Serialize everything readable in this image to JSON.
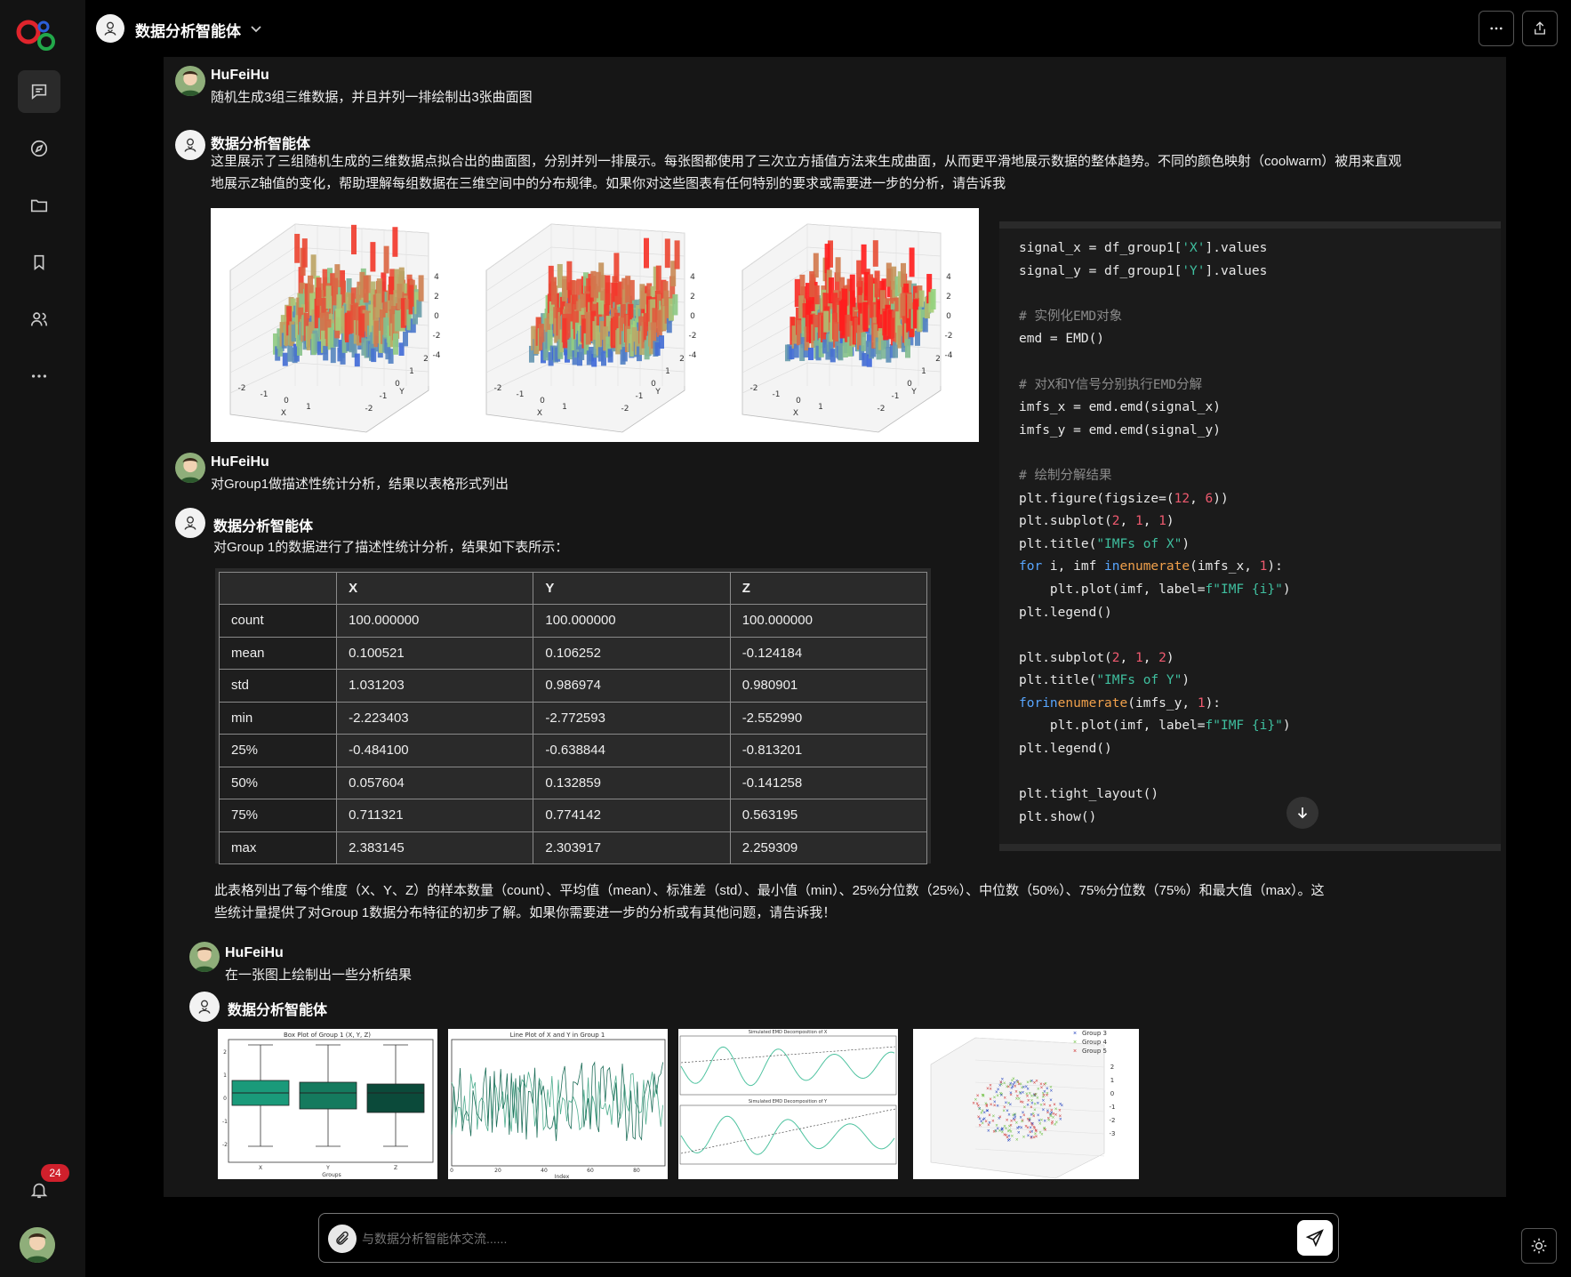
{
  "header": {
    "title": "数据分析智能体"
  },
  "sidebar": {
    "badge": "24"
  },
  "messages": {
    "u1": {
      "name": "HuFeiHu",
      "text": "随机生成3组三维数据，并且并列一排绘制出3张曲面图"
    },
    "b1": {
      "name": "数据分析智能体",
      "line1": "这里展示了三组随机生成的三维数据点拟合出的曲面图，分别并列一排展示。每张图都使用了三次立方插值方法来生成曲面，从而更平滑地展示数据的整体趋势。不同的颜色映射（coolwarm）被用来直观",
      "line2": "地展示Z轴值的变化，帮助理解每组数据在三维空间中的分布规律。如果你对这些图表有任何特别的要求或需要进一步的分析，请告诉我"
    },
    "u2": {
      "name": "HuFeiHu",
      "text": "对Group1做描述性统计分析，结果以表格形式列出"
    },
    "b2": {
      "name": "数据分析智能体",
      "intro": "对Group 1的数据进行了描述性统计分析，结果如下表所示：",
      "summary1": "此表格列出了每个维度（X、Y、Z）的样本数量（count）、平均值（mean）、标准差（std）、最小值（min）、25%分位数（25%）、中位数（50%）、75%分位数（75%）和最大值（max）。这",
      "summary2": "些统计量提供了对Group 1数据分布特征的初步了解。如果你需要进一步的分析或有其他问题，请告诉我！"
    },
    "u3": {
      "name": "HuFeiHu",
      "text": "在一张图上绘制出一些分析结果"
    },
    "b3": {
      "name": "数据分析智能体"
    }
  },
  "surface_axes": {
    "ticks_x": [
      "-2",
      "-1",
      "0",
      "1"
    ],
    "ticks_y": [
      "-2",
      "-1",
      "0",
      "1",
      "2"
    ],
    "xlabel": "X",
    "ylabel": "Y"
  },
  "stats_table": {
    "headers": [
      "",
      "X",
      "Y",
      "Z"
    ],
    "rows": [
      [
        "count",
        "100.000000",
        "100.000000",
        "100.000000"
      ],
      [
        "mean",
        "0.100521",
        "0.106252",
        "-0.124184"
      ],
      [
        "std",
        "1.031203",
        "0.986974",
        "0.980901"
      ],
      [
        "min",
        "-2.223403",
        "-2.772593",
        "-2.552990"
      ],
      [
        "25%",
        "-0.484100",
        "-0.638844",
        "-0.813201"
      ],
      [
        "50%",
        "0.057604",
        "0.132859",
        "-0.141258"
      ],
      [
        "75%",
        "0.711321",
        "0.774142",
        "0.563195"
      ],
      [
        "max",
        "2.383145",
        "2.303917",
        "2.259309"
      ]
    ]
  },
  "code_lines": [
    [
      [
        "",
        "signal_x = df_group1["
      ],
      [
        "st",
        "'X'"
      ],
      [
        "",
        "].values"
      ]
    ],
    [
      [
        "",
        "signal_y = df_group1["
      ],
      [
        "st",
        "'Y'"
      ],
      [
        "",
        "].values"
      ]
    ],
    [],
    [
      [
        "cm",
        "# 实例化EMD对象"
      ]
    ],
    [
      [
        "",
        "emd = EMD()"
      ]
    ],
    [],
    [
      [
        "cm",
        "# 对X和Y信号分别执行EMD分解"
      ]
    ],
    [
      [
        "",
        "imfs_x = emd.emd(signal_x)"
      ]
    ],
    [
      [
        "",
        "imfs_y = emd.emd(signal_y)"
      ]
    ],
    [],
    [
      [
        "cm",
        "# 绘制分解结果"
      ]
    ],
    [
      [
        "",
        "plt.figure(figsize=("
      ],
      [
        "nu",
        "12"
      ],
      [
        "",
        ", "
      ],
      [
        "nu",
        "6"
      ],
      [
        "",
        "))"
      ]
    ],
    [
      [
        "",
        "plt.subplot("
      ],
      [
        "nu",
        "2"
      ],
      [
        "",
        ", "
      ],
      [
        "nu",
        "1"
      ],
      [
        "",
        ", "
      ],
      [
        "nu",
        "1"
      ],
      [
        "",
        ")"
      ]
    ],
    [
      [
        "",
        "plt.title("
      ],
      [
        "st",
        "\"IMFs of X\""
      ],
      [
        "",
        ")"
      ]
    ],
    [
      [
        "kw",
        "for"
      ],
      [
        "",
        " i, imf "
      ],
      [
        "kw",
        "in"
      ],
      [
        "",
        "",
        " "
      ],
      [
        "fn",
        "enumerate"
      ],
      [
        "",
        "(imfs_x, "
      ],
      [
        "nu",
        "1"
      ],
      [
        "",
        "):"
      ]
    ],
    [
      [
        "",
        "    plt.plot(imf, label="
      ],
      [
        "st",
        "f\"IMF {i}\""
      ],
      [
        "",
        ")"
      ]
    ],
    [
      [
        "",
        "plt.legend()"
      ]
    ],
    [],
    [
      [
        "",
        "plt.subplot("
      ],
      [
        "nu",
        "2"
      ],
      [
        "",
        ", "
      ],
      [
        "nu",
        "1"
      ],
      [
        "",
        ", "
      ],
      [
        "nu",
        "2"
      ],
      [
        "",
        ")"
      ]
    ],
    [
      [
        "",
        "plt.title("
      ],
      [
        "st",
        "\"IMFs of Y\""
      ],
      [
        "",
        ")"
      ]
    ],
    [
      [
        "kw",
        "for"
      ],
      [
        "",
        "",
        " i, imf "
      ],
      [
        "kw",
        "in"
      ],
      [
        "",
        "",
        " "
      ],
      [
        "fn",
        "enumerate"
      ],
      [
        "",
        "(imfs_y, "
      ],
      [
        "nu",
        "1"
      ],
      [
        "",
        "):"
      ]
    ],
    [
      [
        "",
        "    plt.plot(imf, label="
      ],
      [
        "st",
        "f\"IMF {i}\""
      ],
      [
        "",
        ")"
      ]
    ],
    [
      [
        "",
        "plt.legend()"
      ]
    ],
    [],
    [
      [
        "",
        "plt.tight_layout()"
      ]
    ],
    [
      [
        "",
        "plt.show()"
      ]
    ]
  ],
  "chart_data": [
    {
      "type": "box",
      "title": "Box Plot of Group 1 (X, Y, Z)",
      "categories": [
        "X",
        "Y",
        "Z"
      ],
      "xlabel": "Groups",
      "y_ticks": [
        "2",
        "1",
        "0",
        "-1",
        "-2"
      ],
      "box_colors": [
        "#1a9a7a",
        "#157a5e",
        "#0b4a3a"
      ]
    },
    {
      "type": "line",
      "title": "Line Plot of X and Y in Group 1",
      "xlabel": "Index",
      "x_ticks": [
        "0",
        "20",
        "40",
        "60",
        "80"
      ]
    },
    {
      "type": "line",
      "titles": [
        "Simulated EMD Decomposition of X",
        "Simulated EMD Decomposition of Y"
      ]
    },
    {
      "type": "scatter",
      "series": [
        {
          "name": "Group 3",
          "color": "#1f3fbf"
        },
        {
          "name": "Group 4",
          "color": "#6bbf3f"
        },
        {
          "name": "Group 5",
          "color": "#d03030"
        }
      ],
      "z_ticks": [
        "2",
        "1",
        "0",
        "-1",
        "-2",
        "-3"
      ]
    }
  ],
  "input": {
    "placeholder": "与数据分析智能体交流......"
  }
}
